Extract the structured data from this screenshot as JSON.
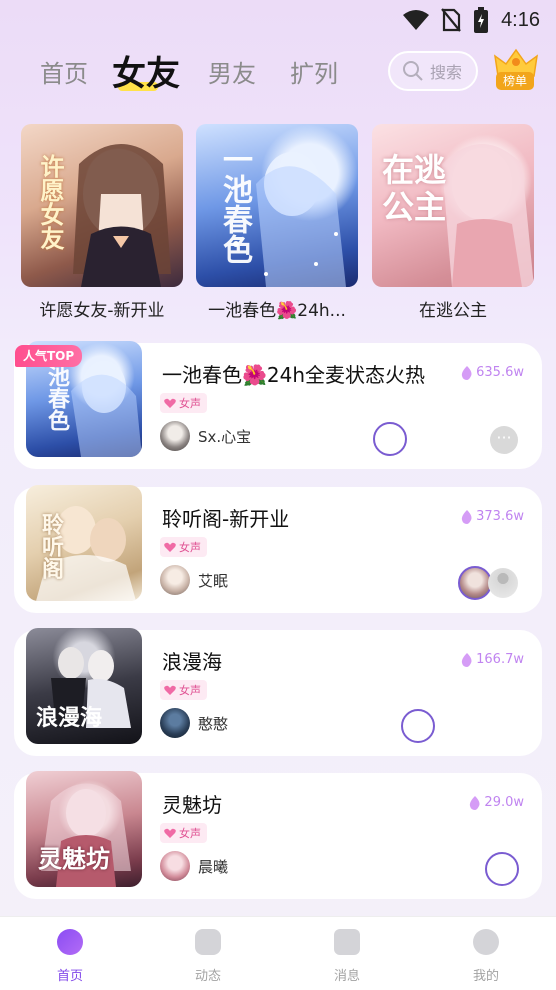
{
  "status_bar": {
    "time": "4:16"
  },
  "top_nav": {
    "tabs": [
      {
        "label": "首页",
        "active": false
      },
      {
        "label": "女友",
        "active": true
      },
      {
        "label": "男友",
        "active": false
      },
      {
        "label": "扩列",
        "active": false
      }
    ],
    "search_placeholder": "搜索",
    "rank_label": "榜单"
  },
  "featured": [
    {
      "title": "许愿女友-新开业",
      "cover_text": "许愿女友"
    },
    {
      "title": "一池春色🌺24h...",
      "cover_text": "一池春色"
    },
    {
      "title": "在逃公主",
      "cover_text": "在逃公主"
    }
  ],
  "rooms": [
    {
      "name": "一池春色🌺24h全麦状态火热",
      "heat": "635.6w",
      "tag": "女声",
      "host": "Sx.心宝",
      "badge": "人气TOP",
      "cover_text": "池春色"
    },
    {
      "name": "聆听阁-新开业",
      "heat": "373.6w",
      "tag": "女声",
      "host": "艾眠",
      "badge": "",
      "cover_text": "聆听阁"
    },
    {
      "name": "浪漫海",
      "heat": "166.7w",
      "tag": "女声",
      "host": "憨憨",
      "badge": "",
      "cover_text": "浪漫海"
    },
    {
      "name": "灵魅坊",
      "heat": "29.0w",
      "tag": "女声",
      "host": "晨曦",
      "badge": "",
      "cover_text": "灵魅坊"
    }
  ],
  "bottom_tabs": [
    {
      "label": "首页",
      "active": true,
      "icon": "home-chat-icon"
    },
    {
      "label": "动态",
      "active": false,
      "icon": "activity-icon"
    },
    {
      "label": "消息",
      "active": false,
      "icon": "message-icon"
    },
    {
      "label": "我的",
      "active": false,
      "icon": "profile-icon"
    }
  ],
  "colors": {
    "accent": "#8249ea",
    "tab_underline": "#ffe24a",
    "heat": "#c084f0",
    "tag_text": "#e05293",
    "top_badge": "#ff4e8e"
  }
}
